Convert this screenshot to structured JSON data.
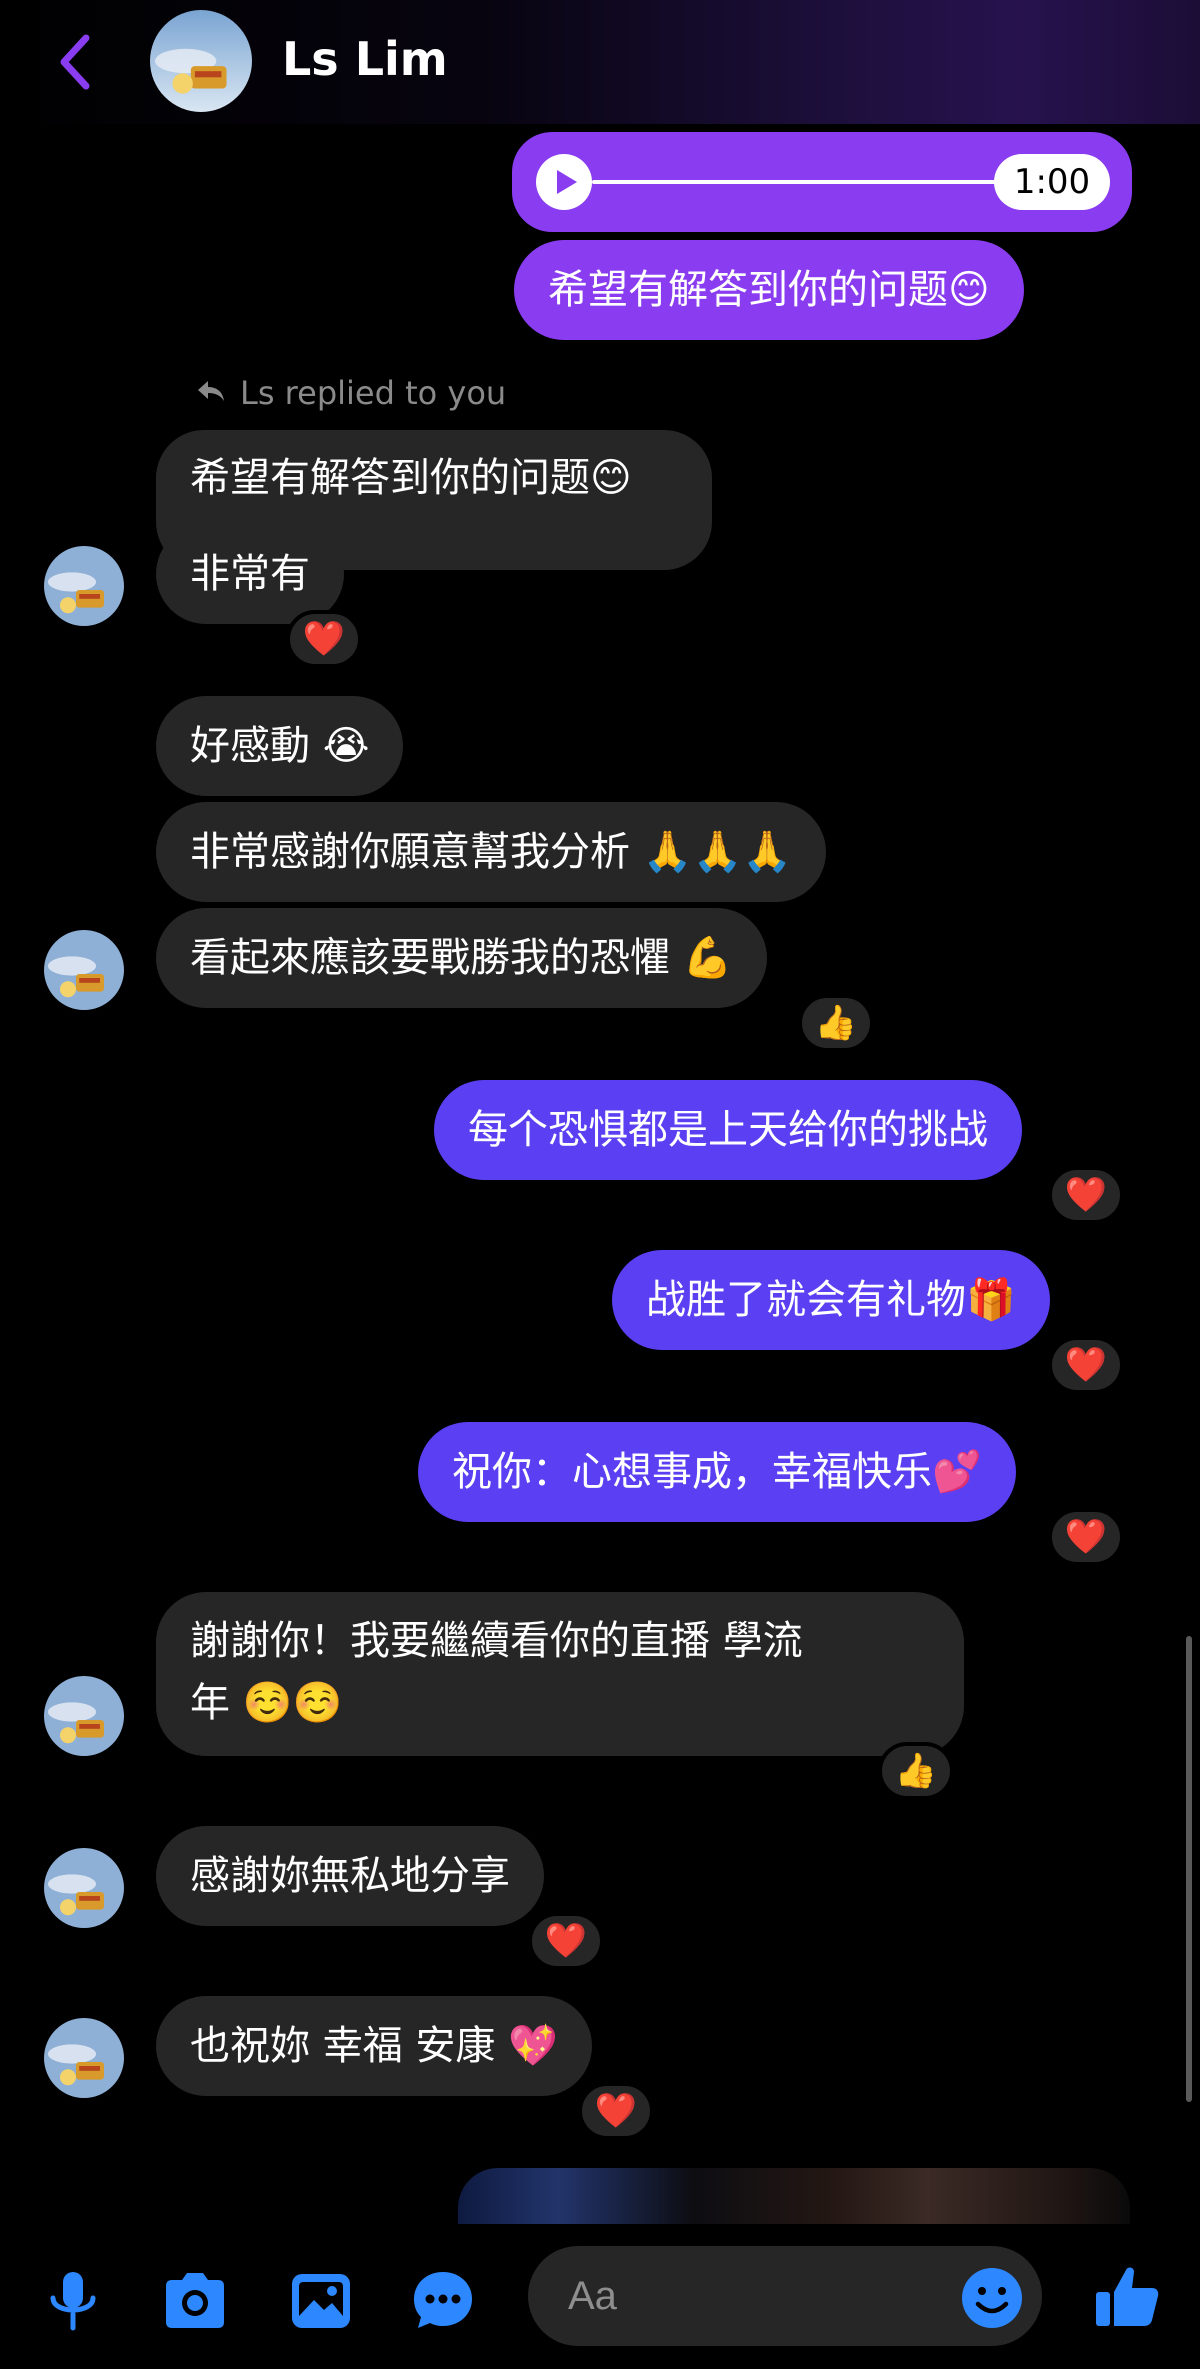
{
  "header": {
    "name": "Ls Lim"
  },
  "audio": {
    "duration": "1:00"
  },
  "reply_label": "Ls replied to you",
  "messages": {
    "m1": "希望有解答到你的问题😊",
    "m2_quoted": "希望有解答到你的问题😊",
    "m3": "非常有",
    "m4": "好感動 😭",
    "m5": "非常感謝你願意幫我分析 🙏🙏🙏",
    "m6": "看起來應該要戰勝我的恐懼 💪",
    "m7": "每个恐惧都是上天给你的挑战",
    "m8": "战胜了就会有礼物🎁",
    "m9": "祝你：心想事成，幸福快乐💕",
    "m10_line1": "謝謝你！我要繼續看你的直播 學流",
    "m10_line2": "年 ☺️☺️",
    "m11": "感謝妳無私地分享",
    "m12": "也祝妳 幸福 安康 💖"
  },
  "reactions": {
    "heart": "❤️",
    "thumbs": "👍"
  },
  "composer": {
    "placeholder": "Aa"
  },
  "colors": {
    "accent_violet": "#8a3cf0",
    "accent_blue": "#5b3ff2",
    "incoming_bubble": "#262626",
    "icon_blue": "#2d88ff"
  },
  "icons": [
    "back-arrow-icon",
    "microphone-icon",
    "camera-icon",
    "image-icon",
    "chat-bubble-icon",
    "smiley-icon",
    "thumbs-up-icon",
    "reply-arrow-icon",
    "play-icon"
  ]
}
